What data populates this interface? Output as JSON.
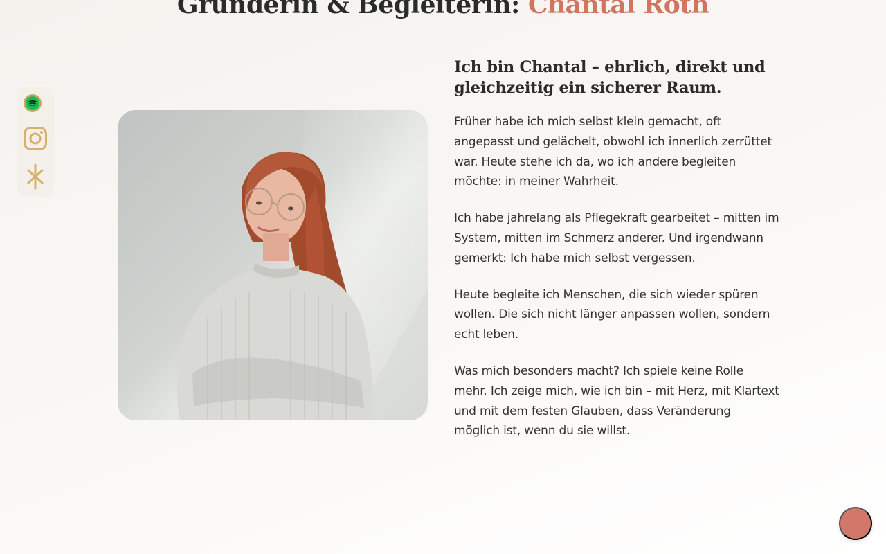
{
  "header": {
    "title_prefix": "Gründerin & Begleiterin: ",
    "title_name": "Chantal Röth"
  },
  "social": {
    "items": [
      {
        "icon": "spotify-icon",
        "color": "#1db954"
      },
      {
        "icon": "instagram-icon",
        "color": "#d6b06b"
      },
      {
        "icon": "asterisk-icon",
        "color": "#d6b06b"
      }
    ]
  },
  "about": {
    "heading": "Ich bin Chantal – ehrlich, direkt und gleichzeitig ein sicherer Raum.",
    "paragraphs": [
      "Früher habe ich mich selbst klein gemacht, oft angepasst und gelächelt, obwohl ich innerlich zerrüttet war. Heute stehe ich da, wo ich andere begleiten möchte: in meiner Wahrheit.",
      "Ich habe jahrelang als Pflegekraft gearbeitet – mitten im System, mitten im Schmerz anderer. Und irgendwann gemerkt: Ich habe mich selbst vergessen.",
      "Heute begleite ich Menschen, die sich wieder spüren wollen. Die sich nicht länger anpassen wollen, sondern echt leben.",
      "Was mich besonders macht? Ich spiele keine Rolle mehr. Ich zeige mich, wie ich bin – mit Herz, mit Klartext und mit dem festen Glauben, dass Veränderung möglich ist, wenn du sie willst."
    ]
  },
  "colors": {
    "accent": "#cf7560",
    "fab": "#d1786a",
    "gold": "#d6b06b"
  }
}
